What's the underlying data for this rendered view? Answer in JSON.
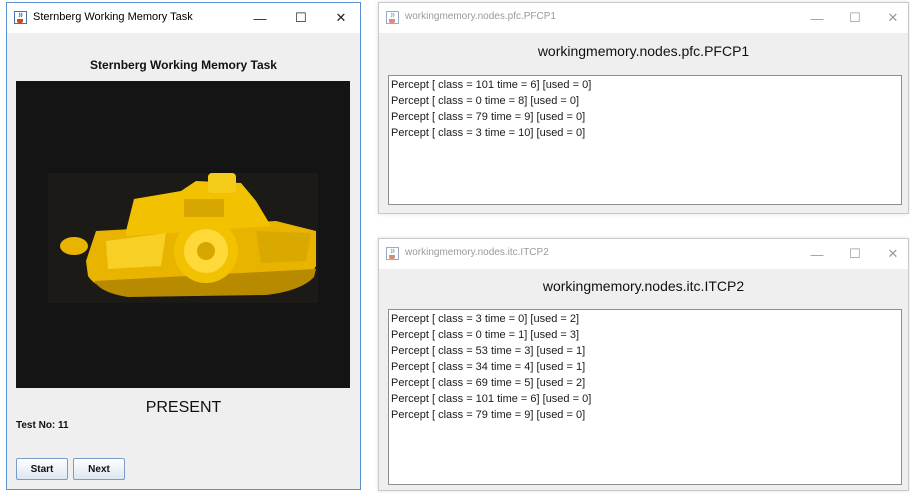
{
  "windows": {
    "sternberg": {
      "title": "Sternberg Working Memory Task",
      "heading": "Sternberg Working Memory Task",
      "stimulus_label": "PRESENT",
      "test_no": "Test No: 11",
      "buttons": {
        "start": "Start",
        "next": "Next"
      }
    },
    "pfc": {
      "title": "workingmemory.nodes.pfc.PFCP1",
      "heading": "workingmemory.nodes.pfc.PFCP1",
      "lines": [
        "Percept [ class = 101 time = 6]  [used = 0]",
        "Percept [ class = 0 time = 8]  [used = 0]",
        "Percept [ class = 79 time = 9]  [used = 0]",
        "Percept [ class = 3 time = 10]  [used = 0]"
      ]
    },
    "itc": {
      "title": "workingmemory.nodes.itc.ITCP2",
      "heading": "workingmemory.nodes.itc.ITCP2",
      "lines": [
        "Percept [ class = 3 time = 0]  [used = 2]",
        "Percept [ class = 0 time = 1]  [used = 3]",
        "Percept [ class = 53 time = 3]  [used = 1]",
        "Percept [ class = 34 time = 4]  [used = 1]",
        "Percept [ class = 69 time = 5]  [used = 2]",
        "Percept [ class = 101 time = 6]  [used = 0]",
        "Percept [ class = 79 time = 9]  [used = 0]"
      ]
    }
  },
  "window_controls": {
    "minimize": "—",
    "maximize": "☐",
    "close": "✕"
  },
  "icons": {
    "app": "java-cup-icon",
    "stimulus": "yellow-toy-boat-image"
  },
  "colors": {
    "active_border": "#5a8fd0",
    "image_bg": "#141414",
    "boat": "#f2c200"
  }
}
